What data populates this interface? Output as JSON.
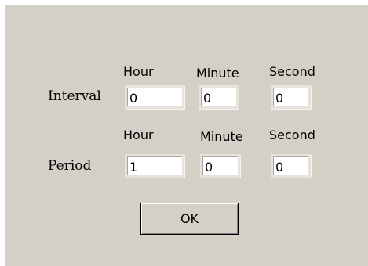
{
  "interval": {
    "label": "Interval",
    "headers": {
      "hour": "Hour",
      "minute": "Minute",
      "second": "Second"
    },
    "values": {
      "hour": "0",
      "minute": "0",
      "second": "0"
    }
  },
  "period": {
    "label": "Period",
    "headers": {
      "hour": "Hour",
      "minute": "Minute",
      "second": "Second"
    },
    "values": {
      "hour": "1",
      "minute": "0",
      "second": "0"
    }
  },
  "ok_label": "OK"
}
